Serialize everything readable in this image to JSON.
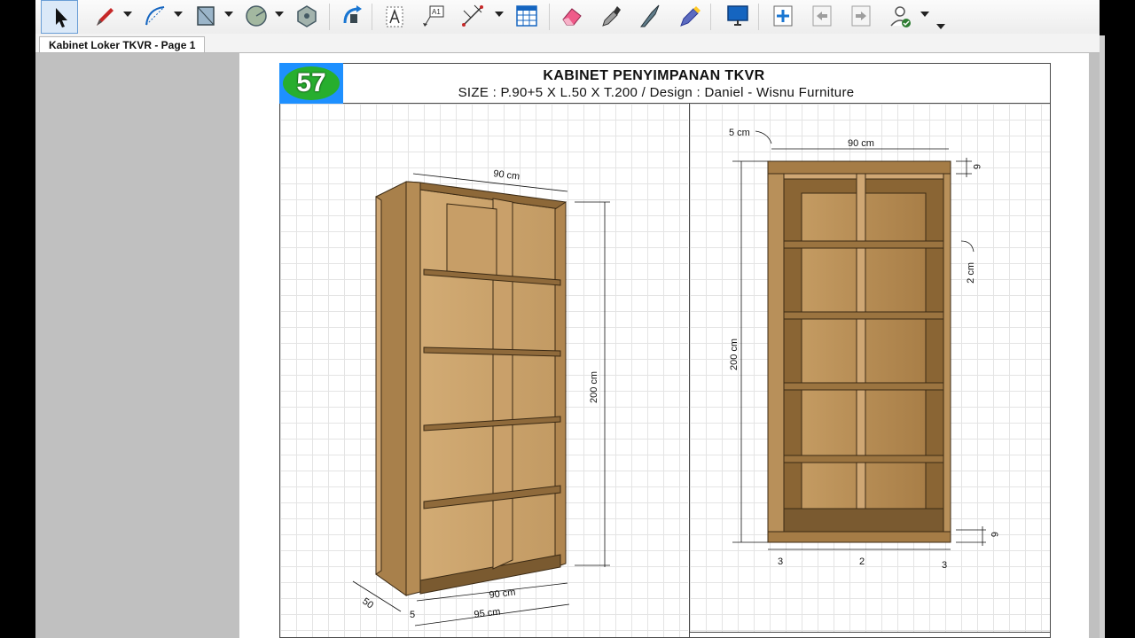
{
  "tab": {
    "label": "Kabinet Loker TKVR - Page 1"
  },
  "toolbar": {
    "tools": [
      {
        "name": "select-tool",
        "icon": "arrow-cursor-icon",
        "active": true
      },
      {
        "name": "pencil-tool",
        "icon": "pencil-icon",
        "dropdown": true
      },
      {
        "name": "arc-tool",
        "icon": "arc-icon",
        "dropdown": true
      },
      {
        "name": "rectangle-tool",
        "icon": "rectangle-icon",
        "dropdown": true
      },
      {
        "name": "circle-tool",
        "icon": "circle-icon",
        "dropdown": true
      },
      {
        "name": "polygon-tool",
        "icon": "polygon-icon"
      },
      {
        "name": "orbit-tool",
        "icon": "orbit-icon"
      },
      {
        "name": "text-tool",
        "icon": "text-icon"
      },
      {
        "name": "label-tool",
        "icon": "label-icon"
      },
      {
        "name": "dimension-tool",
        "icon": "dimension-icon",
        "dropdown": true
      },
      {
        "name": "table-tool",
        "icon": "table-icon"
      },
      {
        "name": "eraser-tool",
        "icon": "eraser-icon"
      },
      {
        "name": "style-tool",
        "icon": "eyedropper-icon"
      },
      {
        "name": "split-tool",
        "icon": "knife-icon"
      },
      {
        "name": "join-tool",
        "icon": "join-icon"
      },
      {
        "name": "presentation-tool",
        "icon": "monitor-icon"
      },
      {
        "name": "add-page-tool",
        "icon": "add-page-icon"
      },
      {
        "name": "previous-page-tool",
        "icon": "previous-page-icon"
      },
      {
        "name": "next-page-tool",
        "icon": "next-page-icon"
      },
      {
        "name": "account-tool",
        "icon": "user-check-icon",
        "dropdown": true
      }
    ]
  },
  "colors": {
    "badge_bg": "#1e90ff",
    "badge_oval": "#27ae2e",
    "wood": "#b38a55",
    "wood_dark": "#7a5a30"
  },
  "sheet": {
    "badge_number": "57",
    "title": "KABINET PENYIMPANAN TKVR",
    "subtitle": "SIZE : P.90+5 X L.50 X T.200 / Design : Daniel - Wisnu Furniture"
  },
  "perspective_view": {
    "dim_width_top": "90 cm",
    "dim_height": "200 cm",
    "dim_width_bottom": "90 cm",
    "dim_total_width": "95 cm",
    "dim_depth": "50",
    "dim_side": "5"
  },
  "front_view": {
    "dim_side_panel": "5 cm",
    "dim_width": "90 cm",
    "dim_top": "6",
    "dim_shelf_thickness": "2 cm",
    "dim_height": "200 cm",
    "dim_bottom": "6",
    "dim_left_panel": "3",
    "dim_divider": "2",
    "dim_right_panel": "3"
  }
}
